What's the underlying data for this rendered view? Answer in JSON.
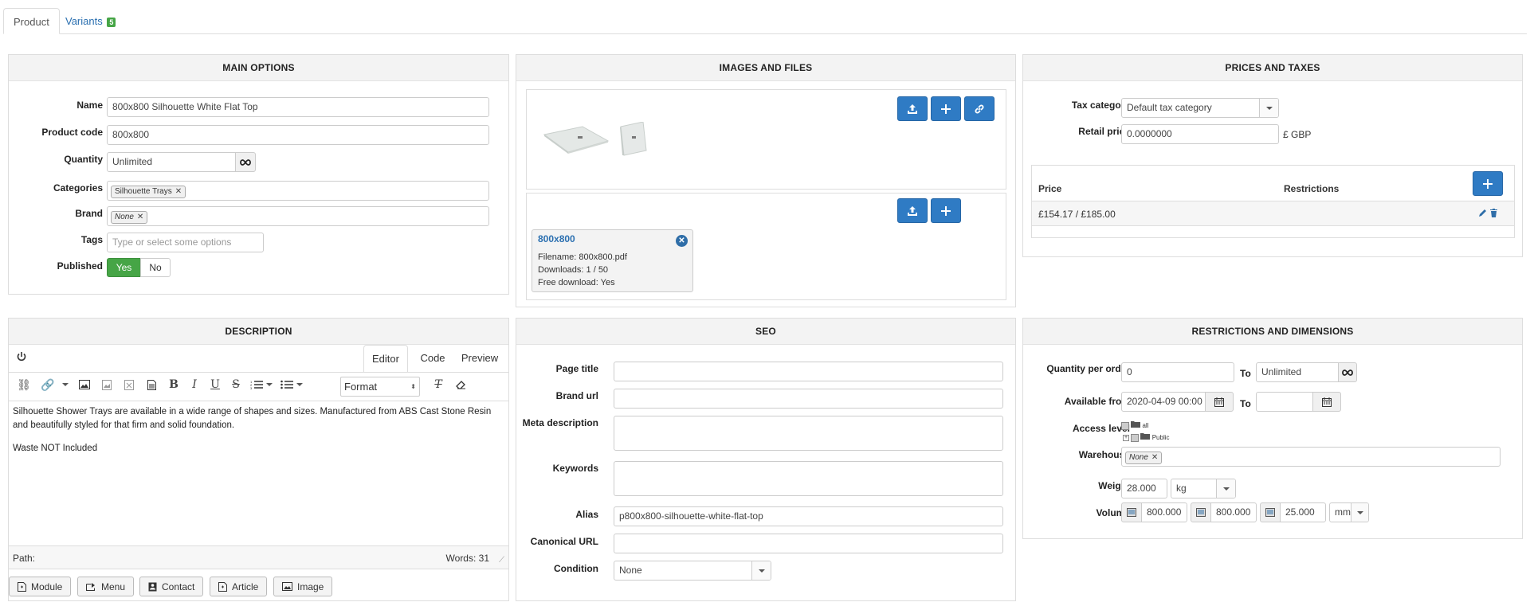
{
  "tabs": {
    "product": "Product",
    "variants": "Variants",
    "variants_count": "5"
  },
  "main": {
    "title": "MAIN OPTIONS",
    "name_label": "Name",
    "name_value": "800x800 Silhouette White Flat Top",
    "code_label": "Product code",
    "code_value": "800x800",
    "qty_label": "Quantity",
    "qty_value": "Unlimited",
    "cat_label": "Categories",
    "cat_tag": "Silhouette Trays",
    "brand_label": "Brand",
    "brand_tag": "None",
    "tags_label": "Tags",
    "tags_placeholder": "Type or select some options",
    "pub_label": "Published",
    "pub_yes": "Yes",
    "pub_no": "No"
  },
  "images": {
    "title": "IMAGES AND FILES",
    "file": {
      "name": "800x800",
      "filename": "Filename: 800x800.pdf",
      "downloads": "Downloads: 1 / 50",
      "free": "Free download: Yes"
    }
  },
  "prices": {
    "title": "PRICES AND TAXES",
    "tax_label": "Tax category",
    "tax_value": "Default tax category",
    "retail_label": "Retail price",
    "retail_value": "0.0000000",
    "currency": "£ GBP",
    "col_price": "Price",
    "col_restrictions": "Restrictions",
    "row_price": "£154.17 / £185.00"
  },
  "description": {
    "title": "DESCRIPTION",
    "tabs": {
      "editor": "Editor",
      "code": "Code",
      "preview": "Preview"
    },
    "format": "Format",
    "text1": "Silhouette Shower Trays are available in a wide range of shapes and sizes. Manufactured from ABS Cast Stone Resin and beautifully styled for that firm and solid foundation.",
    "text2": "Waste NOT Included",
    "path": "Path:",
    "words": "Words: 31",
    "buttons": {
      "module": "Module",
      "menu": "Menu",
      "contact": "Contact",
      "article": "Article",
      "image": "Image"
    }
  },
  "seo": {
    "title": "SEO",
    "page_title_label": "Page title",
    "brand_url_label": "Brand url",
    "meta_label": "Meta description",
    "keywords_label": "Keywords",
    "alias_label": "Alias",
    "alias_value": "p800x800-silhouette-white-flat-top",
    "canonical_label": "Canonical URL",
    "condition_label": "Condition",
    "condition_value": "None"
  },
  "restrictions": {
    "title": "RESTRICTIONS AND DIMENSIONS",
    "qpo_label": "Quantity per order",
    "qpo_from": "0",
    "to": "To",
    "qpo_to": "Unlimited",
    "avail_label": "Available from",
    "avail_from": "2020-04-09 00:00",
    "access_label": "Access level",
    "access_all": "all",
    "access_public": "Public",
    "warehouse_label": "Warehouse",
    "warehouse_tag": "None",
    "weight_label": "Weight",
    "weight_value": "28.000",
    "weight_unit": "kg",
    "volume_label": "Volume",
    "vol_l": "800.000",
    "vol_w": "800.000",
    "vol_h": "25.000",
    "vol_unit": "mm"
  }
}
